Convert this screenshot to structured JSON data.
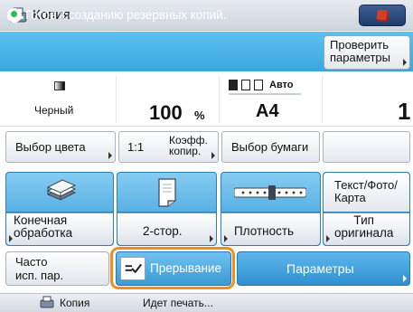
{
  "titlebar": {
    "title": "Копия",
    "app_icon": "copier-icon",
    "stop_icon": "stop-icon"
  },
  "status": {
    "message": "Готов к созданию резервных копий.",
    "status_icon": "ready-indicator-icon",
    "check_button": [
      "Проверить",
      "параметры"
    ]
  },
  "summary": {
    "color_mode": "Черный",
    "ratio_value": "100",
    "ratio_unit": "%",
    "paper_auto": "Авто",
    "paper_size": "A4",
    "copies": "1"
  },
  "quick_buttons": {
    "color_select": "Выбор цвета",
    "ratio_11": "1:1",
    "ratio_label": [
      "Коэфф.",
      "копир."
    ],
    "paper_select": "Выбор бумаги"
  },
  "function_buttons": {
    "finishing": [
      "Конечная",
      "обработка"
    ],
    "duplex": "2-стор.",
    "density": "Плотность",
    "original_type_top": [
      "Текст/Фото/",
      "Карта"
    ],
    "original_type": [
      "Тип",
      "оригинала"
    ]
  },
  "action_buttons": {
    "frequent": [
      "Часто",
      "исп. пар."
    ],
    "interrupt": "Прерывание",
    "parameters": "Параметры"
  },
  "footer": {
    "app": "Копия",
    "status": "Идет печать..."
  },
  "colors": {
    "accent_blue": "#3f9dd6",
    "status_blue": "#4ab2e8",
    "highlight_orange": "#f28c1c",
    "stop_red": "#d43d2b"
  }
}
